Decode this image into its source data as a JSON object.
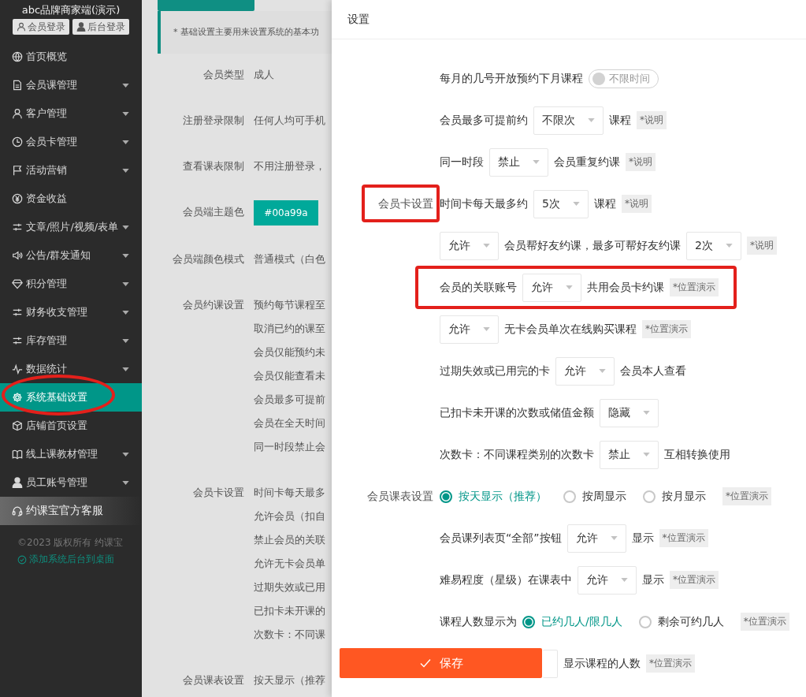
{
  "sidebar": {
    "title": "abc品牌商家端(演示)",
    "login_buttons": [
      "会员登录",
      "后台登录"
    ],
    "items": [
      {
        "label": "首页概览",
        "expandable": false,
        "selected": false,
        "circled": false
      },
      {
        "label": "会员课管理",
        "expandable": true,
        "selected": false,
        "circled": false
      },
      {
        "label": "客户管理",
        "expandable": true,
        "selected": false,
        "circled": false
      },
      {
        "label": "会员卡管理",
        "expandable": true,
        "selected": false,
        "circled": false
      },
      {
        "label": "活动营销",
        "expandable": true,
        "selected": false,
        "circled": false
      },
      {
        "label": "资金收益",
        "expandable": false,
        "selected": false,
        "circled": false
      },
      {
        "label": "文章/照片/视频/表单",
        "expandable": true,
        "selected": false,
        "circled": false
      },
      {
        "label": "公告/群发通知",
        "expandable": true,
        "selected": false,
        "circled": false
      },
      {
        "label": "积分管理",
        "expandable": true,
        "selected": false,
        "circled": false
      },
      {
        "label": "财务收支管理",
        "expandable": true,
        "selected": false,
        "circled": false
      },
      {
        "label": "库存管理",
        "expandable": true,
        "selected": false,
        "circled": false
      },
      {
        "label": "数据统计",
        "expandable": true,
        "selected": false,
        "circled": false
      },
      {
        "label": "系统基础设置",
        "expandable": false,
        "selected": true,
        "circled": true
      },
      {
        "label": "店铺首页设置",
        "expandable": false,
        "selected": false,
        "circled": false
      },
      {
        "label": "线上课教材管理",
        "expandable": true,
        "selected": false,
        "circled": false
      },
      {
        "label": "员工账号管理",
        "expandable": true,
        "selected": false,
        "circled": false
      }
    ],
    "service": "约课宝官方客服",
    "copyright": "©2023 版权所有 约课宝",
    "desktop_link": "添加系统后台到桌面"
  },
  "page": {
    "notice": "* 基础设置主要用来设置系统的基本功",
    "rows": [
      {
        "label": "会员类型",
        "kind": "text",
        "lines": [
          "成人"
        ]
      },
      {
        "label": "注册登录限制",
        "kind": "text",
        "lines": [
          "任何人均可手机"
        ]
      },
      {
        "label": "查看课表限制",
        "kind": "text",
        "lines": [
          "不用注册登录，"
        ]
      },
      {
        "label": "会员端主题色",
        "kind": "color",
        "value": "#00a99a"
      },
      {
        "label": "会员端颜色模式",
        "kind": "text",
        "lines": [
          "普通模式（白色"
        ]
      },
      {
        "label": "会员约课设置",
        "kind": "text",
        "lines": [
          "预约每节课程至",
          "取消已约的课至",
          "会员仅能预约未",
          "会员仅能查看未",
          "会员最多可提前",
          "会员在全天时间",
          "同一时段禁止会"
        ]
      },
      {
        "label": "会员卡设置",
        "kind": "text",
        "lines": [
          "时间卡每天最多",
          "允许会员（扣自",
          "禁止会员的关联",
          "允许无卡会员单",
          "过期失效或已用",
          "已扣卡未开课的",
          "次数卡：不同课"
        ]
      },
      {
        "label": "会员课表设置",
        "kind": "text",
        "lines": [
          "按天显示（推荐"
        ]
      }
    ]
  },
  "drawer": {
    "title": "设置",
    "save_button": "保存",
    "rows": [
      {
        "parts": [
          {
            "kind": "text",
            "text": "每月的几号开放预约下月课程"
          },
          {
            "kind": "toggle",
            "text": "不限时间",
            "on": false
          }
        ]
      },
      {
        "parts": [
          {
            "kind": "text",
            "text": "会员最多可提前约"
          },
          {
            "kind": "select",
            "value": "不限次"
          },
          {
            "kind": "text",
            "text": "课程"
          },
          {
            "kind": "tag",
            "text": "*说明"
          }
        ]
      },
      {
        "parts": [
          {
            "kind": "text",
            "text": "同一时段"
          },
          {
            "kind": "select",
            "value": "禁止"
          },
          {
            "kind": "text",
            "text": "会员重复约课"
          },
          {
            "kind": "tag",
            "text": "*说明"
          }
        ]
      },
      {
        "label": "会员卡设置",
        "label_annotated": true,
        "parts": [
          {
            "kind": "text",
            "text": "时间卡每天最多约"
          },
          {
            "kind": "select",
            "value": "5次"
          },
          {
            "kind": "text",
            "text": "课程"
          },
          {
            "kind": "tag",
            "text": "*说明"
          }
        ]
      },
      {
        "parts": [
          {
            "kind": "select",
            "value": "允许"
          },
          {
            "kind": "text",
            "text": "会员帮好友约课，最多可帮好友约课"
          },
          {
            "kind": "select",
            "value": "2次"
          },
          {
            "kind": "tag",
            "text": "*说明"
          }
        ]
      },
      {
        "annotated": true,
        "parts": [
          {
            "kind": "text",
            "text": "会员的关联账号"
          },
          {
            "kind": "select",
            "value": "允许"
          },
          {
            "kind": "text",
            "text": "共用会员卡约课"
          },
          {
            "kind": "tag",
            "text": "*位置演示"
          }
        ]
      },
      {
        "parts": [
          {
            "kind": "select",
            "value": "允许"
          },
          {
            "kind": "text",
            "text": "无卡会员单次在线购买课程"
          },
          {
            "kind": "tag",
            "text": "*位置演示"
          }
        ]
      },
      {
        "parts": [
          {
            "kind": "text",
            "text": "过期失效或已用完的卡"
          },
          {
            "kind": "select",
            "value": "允许"
          },
          {
            "kind": "text",
            "text": "会员本人查看"
          }
        ]
      },
      {
        "parts": [
          {
            "kind": "text",
            "text": "已扣卡未开课的次数或储值金额"
          },
          {
            "kind": "select",
            "value": "隐藏"
          }
        ]
      },
      {
        "parts": [
          {
            "kind": "text",
            "text": "次数卡：不同课程类别的次数卡"
          },
          {
            "kind": "select",
            "value": "禁止"
          },
          {
            "kind": "text",
            "text": "互相转换使用"
          }
        ]
      },
      {
        "label": "会员课表设置",
        "parts": [
          {
            "kind": "radio",
            "text": "按天显示（推荐）",
            "selected": true
          },
          {
            "kind": "radio",
            "text": "按周显示",
            "selected": false
          },
          {
            "kind": "radio",
            "text": "按月显示",
            "selected": false
          },
          {
            "kind": "tag",
            "text": "*位置演示"
          }
        ]
      },
      {
        "parts": [
          {
            "kind": "text",
            "text": "会员课列表页“全部”按钮"
          },
          {
            "kind": "select",
            "value": "允许"
          },
          {
            "kind": "text",
            "text": "显示"
          },
          {
            "kind": "tag",
            "text": "*位置演示"
          }
        ]
      },
      {
        "parts": [
          {
            "kind": "text",
            "text": "难易程度（星级）在课表中"
          },
          {
            "kind": "select",
            "value": "允许"
          },
          {
            "kind": "text",
            "text": "显示"
          },
          {
            "kind": "tag",
            "text": "*位置演示"
          }
        ]
      },
      {
        "parts": [
          {
            "kind": "text",
            "text": "课程人数显示为"
          },
          {
            "kind": "radio",
            "text": "已约几人/限几人",
            "selected": true
          },
          {
            "kind": "radio",
            "text": "剩余可约几人",
            "selected": false
          },
          {
            "kind": "tag",
            "text": "*位置演示"
          }
        ]
      },
      {
        "parts": [
          {
            "kind": "select"
          },
          {
            "kind": "text",
            "text": "显示课程的人数"
          },
          {
            "kind": "tag",
            "text": "*位置演示"
          }
        ]
      }
    ]
  }
}
